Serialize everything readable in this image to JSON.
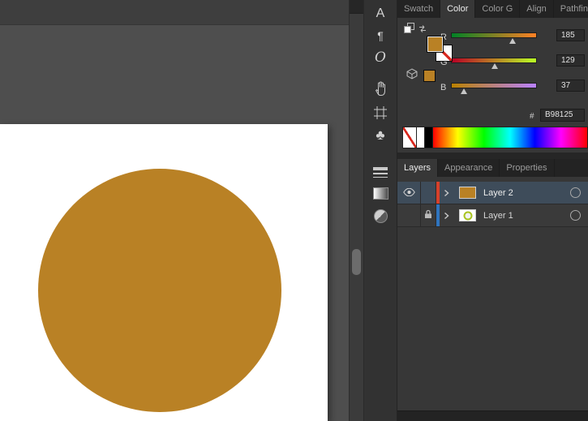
{
  "artwork": {
    "fill": "#B98125"
  },
  "tool_strip": {
    "icons": [
      {
        "name": "character-panel-icon",
        "glyph": "A"
      },
      {
        "name": "paragraph-panel-icon",
        "glyph": "¶"
      },
      {
        "name": "glyphs-panel-icon",
        "glyph": "O"
      },
      {
        "name": "shaper-hand-icon",
        "glyph": ""
      },
      {
        "name": "artboards-panel-icon",
        "glyph": ""
      },
      {
        "name": "symbols-panel-icon",
        "glyph": "♣"
      },
      {
        "name": "stroke-panel-icon",
        "glyph": ""
      },
      {
        "name": "gradient-panel-icon",
        "glyph": ""
      },
      {
        "name": "transparency-panel-icon",
        "glyph": ""
      }
    ]
  },
  "color_panel": {
    "tabs": [
      {
        "label": "Swatch",
        "active": false
      },
      {
        "label": "Color",
        "active": true
      },
      {
        "label": "Color G",
        "active": false
      },
      {
        "label": "Align",
        "active": false
      },
      {
        "label": "Pathfin",
        "active": false
      }
    ],
    "sliders": [
      {
        "label": "R",
        "value": "185",
        "pct": "72.5%"
      },
      {
        "label": "G",
        "value": "129",
        "pct": "50.6%"
      },
      {
        "label": "B",
        "value": "37",
        "pct": "14.5%"
      }
    ],
    "hex_prefix": "#",
    "hex_value": "B98125",
    "fill_color": "#B98125"
  },
  "layers_panel": {
    "tabs": [
      {
        "label": "Layers",
        "active": true
      },
      {
        "label": "Appearance",
        "active": false
      },
      {
        "label": "Properties",
        "active": false
      }
    ],
    "layers": [
      {
        "name": "Layer 2",
        "selected": true,
        "visible": true,
        "locked": false,
        "accent": "#D6402B",
        "thumb": "#B98125"
      },
      {
        "name": "Layer 1",
        "selected": false,
        "visible": false,
        "locked": true,
        "accent": "#2F74BE"
      }
    ]
  }
}
